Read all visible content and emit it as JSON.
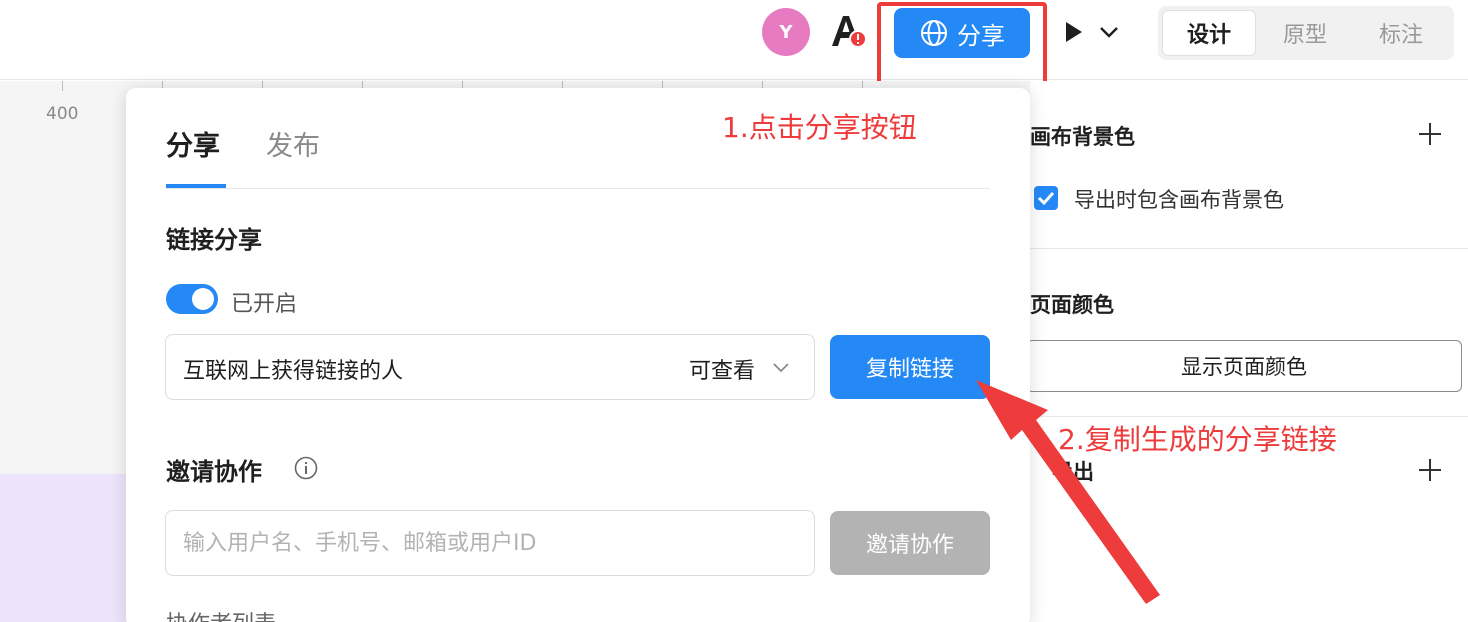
{
  "topbar": {
    "avatar_initial": "Y",
    "share_label": "分享",
    "mode_tabs": [
      {
        "label": "设计",
        "active": true
      },
      {
        "label": "原型",
        "active": false
      },
      {
        "label": "标注",
        "active": false
      }
    ],
    "icons": [
      "font-warning-icon",
      "globe-icon",
      "play-icon",
      "chevron-down-icon"
    ]
  },
  "canvas": {
    "ruler_label": "400"
  },
  "share_popup": {
    "tabs": [
      {
        "label": "分享",
        "active": true
      },
      {
        "label": "发布",
        "active": false
      }
    ],
    "link_share": {
      "title": "链接分享",
      "toggle_label": "已开启",
      "toggle_on": true,
      "audience": "互联网上获得链接的人",
      "permission": "可查看",
      "copy_label": "复制链接"
    },
    "invite": {
      "title": "邀请协作",
      "placeholder": "输入用户名、手机号、邮箱或用户ID",
      "button_label": "邀请协作",
      "collaborators_heading": "协作者列表"
    }
  },
  "right_panel": {
    "canvas_bg_title": "画布背景色",
    "export_bg_label": "导出时包含画布背景色",
    "export_bg_checked": true,
    "page_color_title": "页面颜色",
    "show_page_color_label": "显示页面颜色",
    "export_partial_title": "导出"
  },
  "annotations": {
    "step1": "1.点击分享按钮",
    "step2": "2.复制生成的分享链接"
  },
  "colors": {
    "accent": "#2589f5",
    "annotation": "#ee3b3b",
    "avatar": "#e67bc2",
    "disabled_button": "#b3b3b3"
  }
}
